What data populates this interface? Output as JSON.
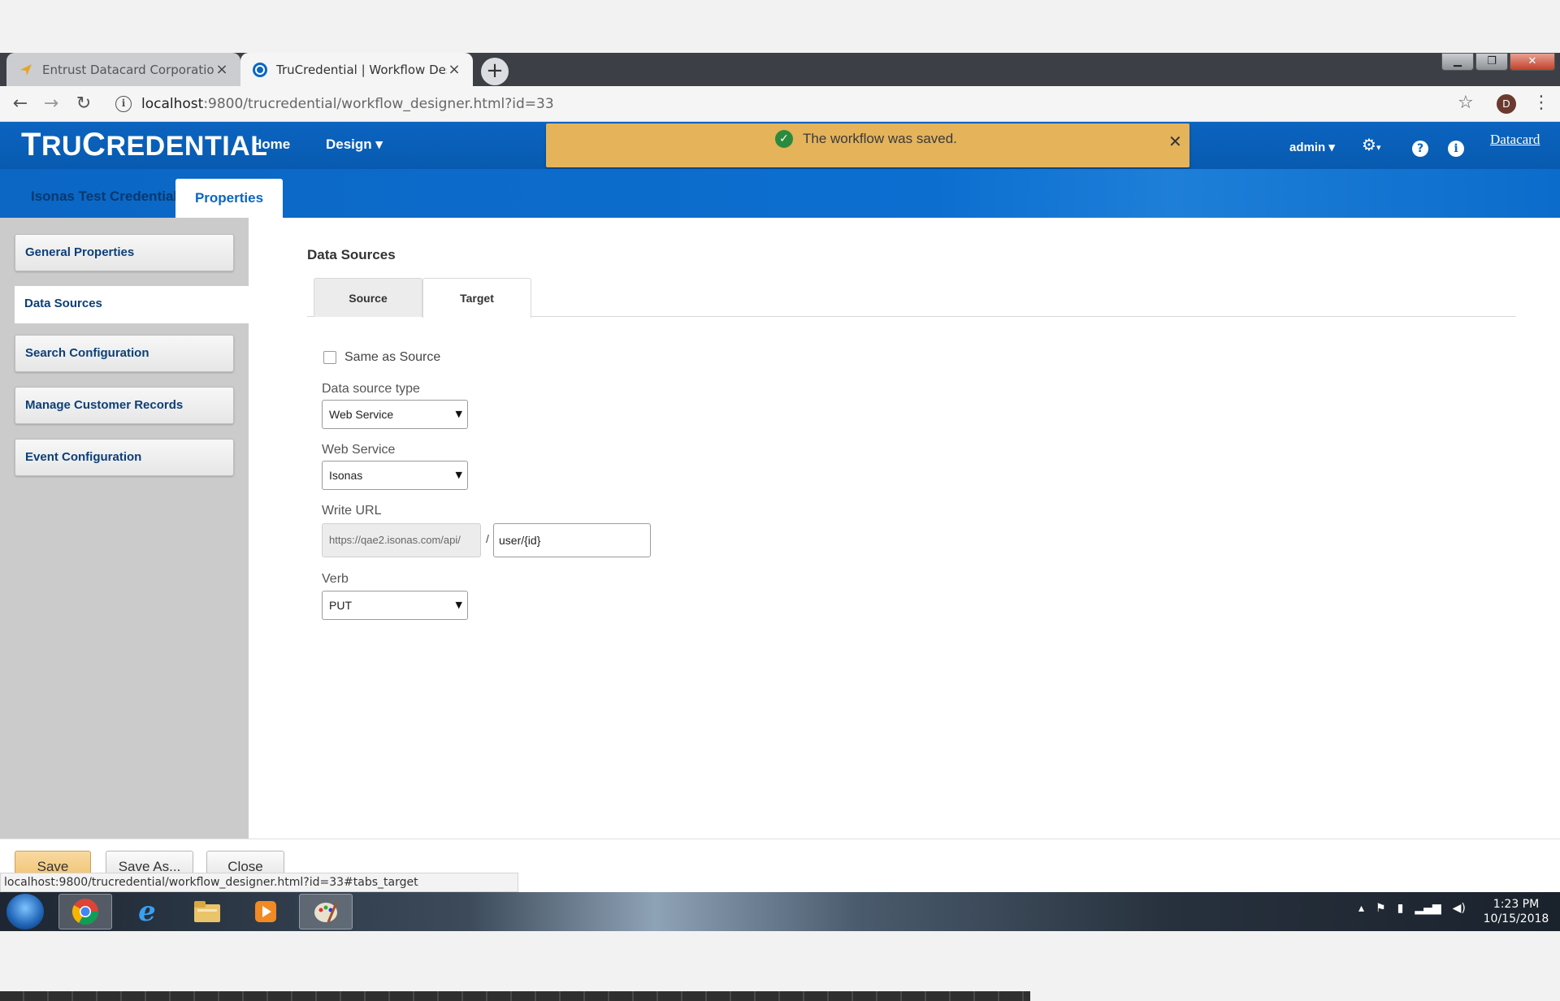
{
  "browser": {
    "tabs": [
      {
        "title": "Entrust Datacard Corporation M",
        "active": false
      },
      {
        "title": "TruCredential | Workflow Design",
        "active": true
      }
    ],
    "url": {
      "host": "localhost",
      "rest": ":9800/trucredential/workflow_designer.html?id=33"
    },
    "profile_initial": "D"
  },
  "app": {
    "logo": {
      "t": "T",
      "ru": "RU",
      "c": "C",
      "redential": "REDENTIAL"
    },
    "nav": {
      "home": "Home",
      "design": "Design ▾"
    },
    "toast": {
      "message": "The workflow was saved."
    },
    "admin": "admin ▾",
    "brand": "Datacard",
    "tabs": {
      "project": "Isonas Test Credential",
      "properties": "Properties"
    }
  },
  "sidebar": {
    "items": [
      {
        "label": "General Properties"
      },
      {
        "label": "Data Sources"
      },
      {
        "label": "Search Configuration"
      },
      {
        "label": "Manage Customer Records"
      },
      {
        "label": "Event Configuration"
      }
    ]
  },
  "main": {
    "title": "Data Sources",
    "tabs": {
      "source": "Source",
      "target": "Target"
    },
    "same_as_source": {
      "label": "Same as Source",
      "checked": false
    },
    "data_source_type": {
      "label": "Data source type",
      "value": "Web Service"
    },
    "web_service": {
      "label": "Web Service",
      "value": "Isonas"
    },
    "write_url": {
      "label": "Write URL",
      "prefix": "https://qae2.isonas.com/api/",
      "separator": "/",
      "path": "user/{id}"
    },
    "verb": {
      "label": "Verb",
      "value": "PUT"
    }
  },
  "actions": {
    "save": "Save",
    "save_as": "Save As...",
    "close": "Close"
  },
  "status_url": "localhost:9800/trucredential/workflow_designer.html?id=33#tabs_target",
  "taskbar": {
    "time": "1:23 PM",
    "date": "10/15/2018"
  },
  "colors": {
    "header_blue": "#0b66c4",
    "toast": "#e4b35a",
    "save_button": "#efc06c"
  }
}
